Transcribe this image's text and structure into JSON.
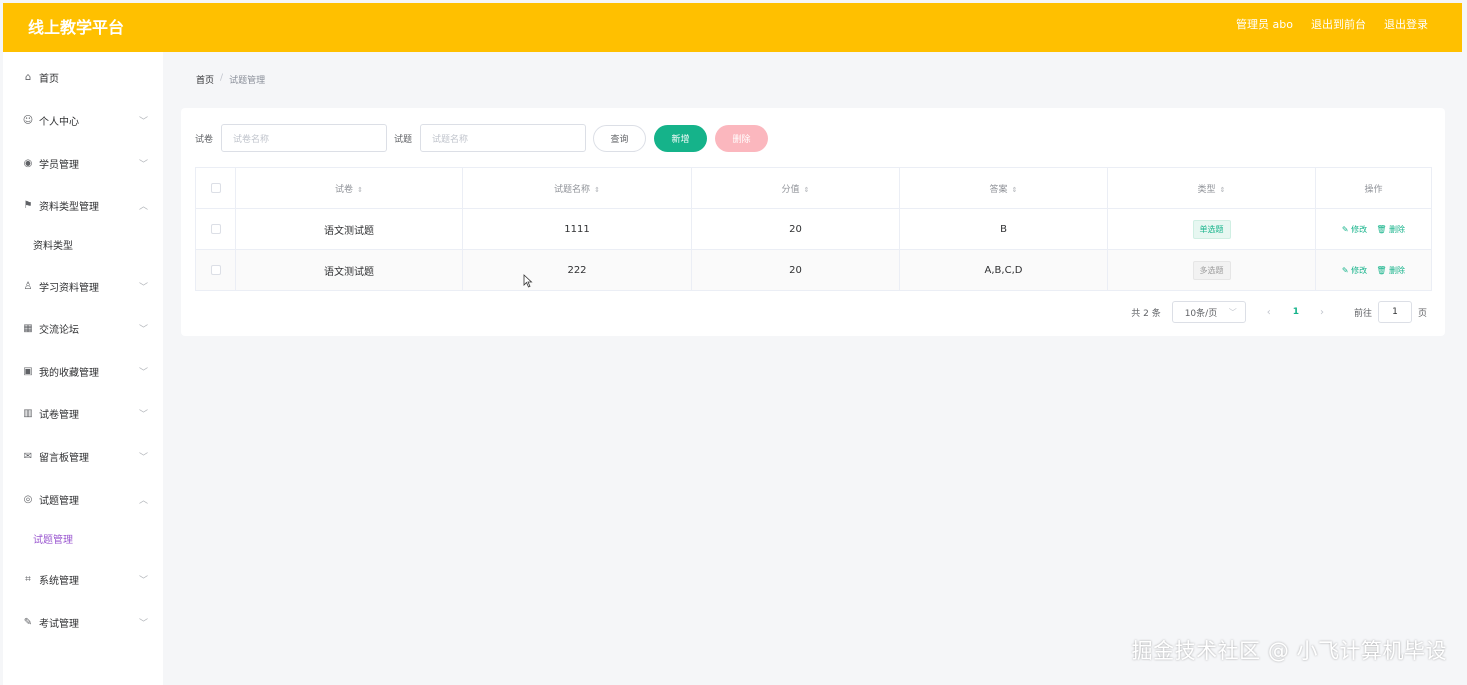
{
  "header": {
    "brand": "线上教学平台",
    "user": "管理员 abo",
    "exit_front": "退出到前台",
    "logout": "退出登录",
    "colors": {
      "topbar": "#ffc000"
    }
  },
  "sidebar": {
    "items": [
      {
        "label": "首页",
        "icon": "home-icon",
        "glyph": "⌂"
      },
      {
        "label": "个人中心",
        "icon": "user-icon",
        "glyph": "☺"
      },
      {
        "label": "学员管理",
        "icon": "location-icon",
        "glyph": "◉"
      },
      {
        "label": "资料类型管理",
        "icon": "flag-icon",
        "glyph": "⚑"
      },
      {
        "label": "资料类型"
      },
      {
        "label": "学习资料管理",
        "icon": "person-icon",
        "glyph": "♙"
      },
      {
        "label": "交流论坛",
        "icon": "grid-icon",
        "glyph": "▦"
      },
      {
        "label": "我的收藏管理",
        "icon": "picture-icon",
        "glyph": "▣"
      },
      {
        "label": "试卷管理",
        "icon": "chart-icon",
        "glyph": "▥"
      },
      {
        "label": "留言板管理",
        "icon": "mail-icon",
        "glyph": "✉"
      },
      {
        "label": "试题管理",
        "icon": "circle-icon",
        "glyph": "◎"
      },
      {
        "label": "试题管理"
      },
      {
        "label": "系统管理",
        "icon": "crop-icon",
        "glyph": "⌗"
      },
      {
        "label": "考试管理",
        "icon": "pen-icon",
        "glyph": "✎"
      }
    ]
  },
  "breadcrumb": {
    "home": "首页",
    "sep": "/",
    "current": "试题管理"
  },
  "search": {
    "paper_label": "试卷",
    "paper_placeholder": "试卷名称",
    "question_label": "试题",
    "question_placeholder": "试题名称",
    "query_btn": "查询",
    "add_btn": "新增",
    "delete_btn": "删除"
  },
  "table": {
    "columns": [
      "试卷",
      "试题名称",
      "分值",
      "答案",
      "类型",
      "操作"
    ],
    "sort_glyph": "⇕",
    "rows": [
      {
        "paper": "语文测试题",
        "question": "1111",
        "score": "20",
        "answer": "B",
        "type": "单选题",
        "type_style": "single"
      },
      {
        "paper": "语文测试题",
        "question": "222",
        "score": "20",
        "answer": "A,B,C,D",
        "type": "多选题",
        "type_style": "multi"
      }
    ],
    "edit": "✎ 修改",
    "remove": "🗑 删除"
  },
  "pagination": {
    "total": "共 2 条",
    "page_size": "10条/页",
    "prev": "‹",
    "page": "1",
    "next": "›",
    "goto": "前往",
    "goto_value": "1",
    "goto_suffix": "页"
  },
  "watermark": "掘金技术社区 @ 小飞计算机毕设"
}
